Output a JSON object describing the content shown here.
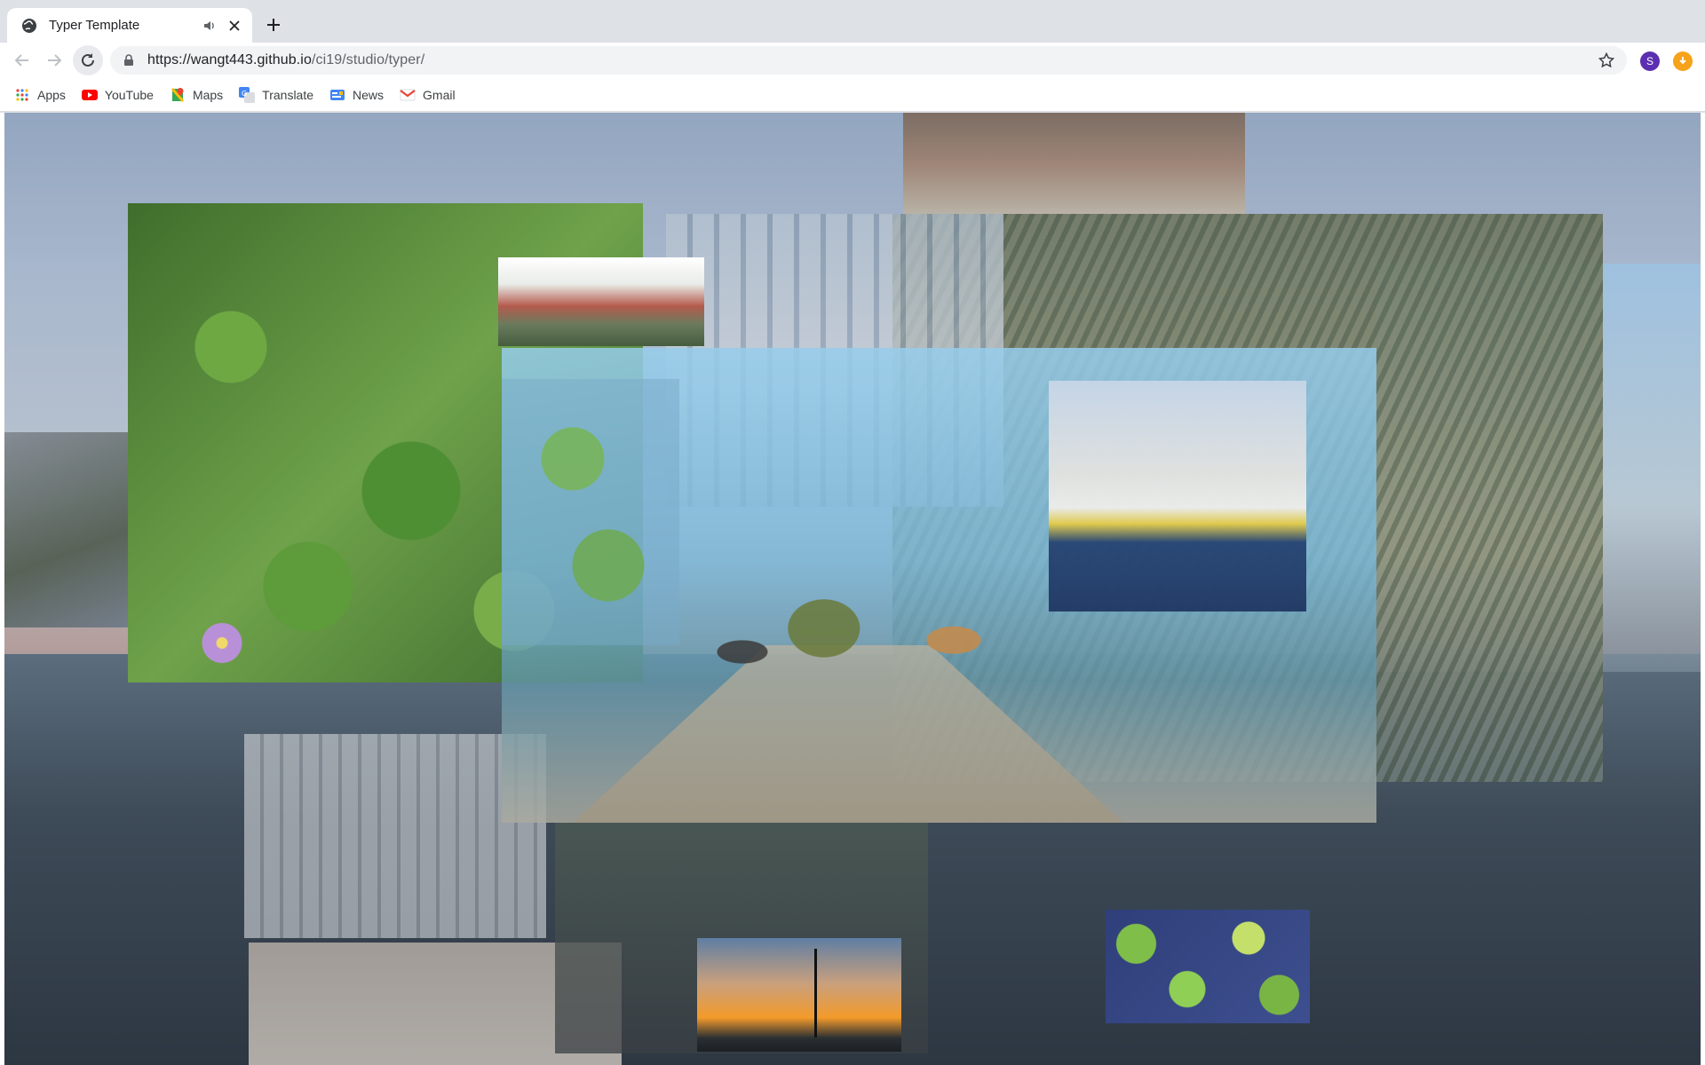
{
  "browser": {
    "tab": {
      "title": "Typer Template"
    },
    "toolbar": {
      "url_host": "https://wangt443.github.io",
      "url_path": "/ci19/studio/typer/",
      "profile_initial": "S"
    },
    "bookmarks": [
      {
        "label": "Apps",
        "icon": "apps-grid-icon"
      },
      {
        "label": "YouTube",
        "icon": "youtube-icon"
      },
      {
        "label": "Maps",
        "icon": "maps-icon"
      },
      {
        "label": "Translate",
        "icon": "translate-icon"
      },
      {
        "label": "News",
        "icon": "news-icon"
      },
      {
        "label": "Gmail",
        "icon": "gmail-icon"
      }
    ]
  },
  "colors": {
    "tabstrip": "#dee1e6",
    "omnibox": "#f1f3f4",
    "profile": "#5b2fb0",
    "extension": "#f7a21b"
  }
}
